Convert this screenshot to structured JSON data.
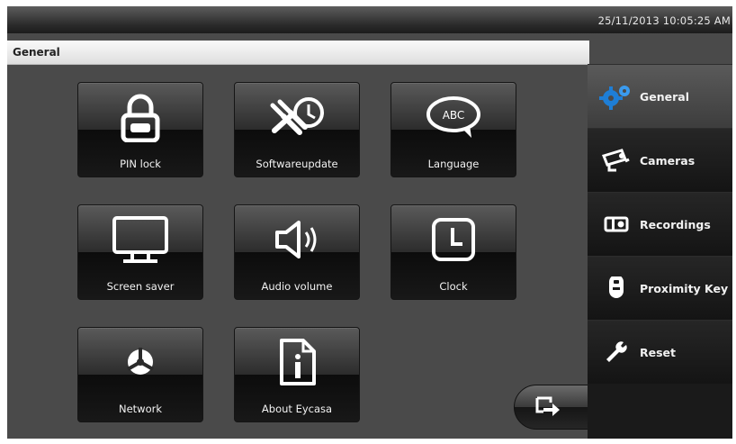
{
  "status_bar": {
    "datetime": "25/11/2013 10:05:25 AM"
  },
  "header": {
    "title": "General"
  },
  "tiles": [
    {
      "label": "PIN lock",
      "icon": "lock-icon"
    },
    {
      "label": "Softwareupdate",
      "icon": "tools-icon"
    },
    {
      "label": "Language",
      "icon": "speech-bubble-icon",
      "icon_text": "ABC"
    },
    {
      "label": "Screen saver",
      "icon": "monitor-icon"
    },
    {
      "label": "Audio volume",
      "icon": "speaker-icon"
    },
    {
      "label": "Clock",
      "icon": "clock-icon"
    },
    {
      "label": "Network",
      "icon": "network-icon"
    },
    {
      "label": "About Eycasa",
      "icon": "info-icon"
    }
  ],
  "sidebar": {
    "items": [
      {
        "label": "General",
        "icon": "gears-icon",
        "active": true
      },
      {
        "label": "Cameras",
        "icon": "camera-icon"
      },
      {
        "label": "Recordings",
        "icon": "recording-icon"
      },
      {
        "label": "Proximity Key",
        "icon": "key-fob-icon"
      },
      {
        "label": "Reset",
        "icon": "wrench-icon"
      }
    ]
  },
  "exit_button": {
    "icon": "exit-icon"
  },
  "colors": {
    "accent": "#1e7ed6",
    "text": "#f2f2f2"
  }
}
